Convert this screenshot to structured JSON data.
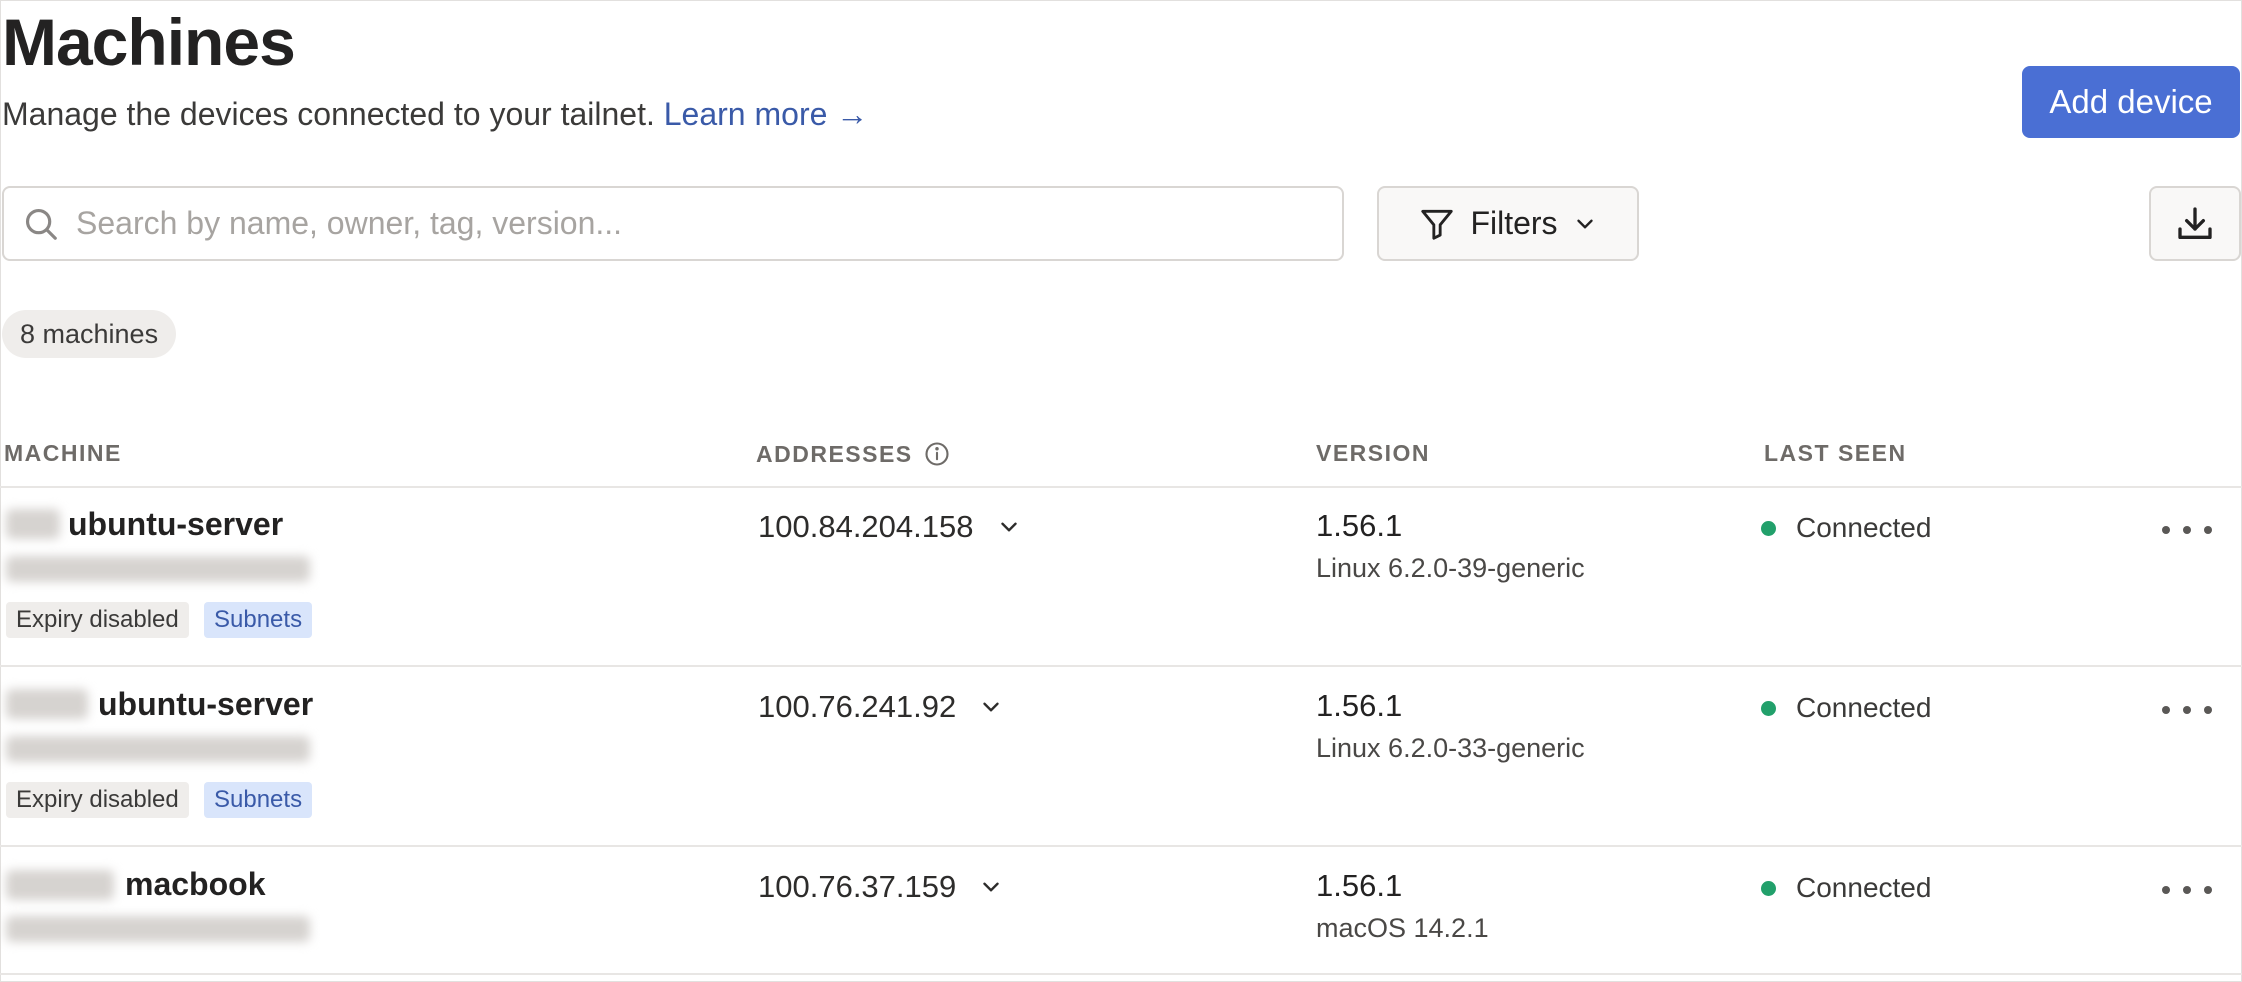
{
  "header": {
    "title": "Machines",
    "subtitle": "Manage the devices connected to your tailnet.",
    "learn_more": "Learn more →",
    "add_device": "Add device"
  },
  "toolbar": {
    "search_placeholder": "Search by name, owner, tag, version...",
    "filters_label": "Filters",
    "icons": {
      "search": "search-icon",
      "filter": "filter-icon",
      "chevron": "chevron-down-icon",
      "download": "download-icon"
    }
  },
  "summary": {
    "count_label": "8 machines"
  },
  "columns": {
    "machine": "MACHINE",
    "addresses": "ADDRESSES",
    "version": "VERSION",
    "last_seen": "LAST SEEN"
  },
  "machines": [
    {
      "name": "ubuntu-server",
      "address": "100.84.204.158",
      "version": "1.56.1",
      "os": "Linux 6.2.0-39-generic",
      "status": "Connected",
      "tags": [
        "Expiry disabled",
        "Subnets"
      ]
    },
    {
      "name": "ubuntu-server",
      "address": "100.76.241.92",
      "version": "1.56.1",
      "os": "Linux 6.2.0-33-generic",
      "status": "Connected",
      "tags": [
        "Expiry disabled",
        "Subnets"
      ]
    },
    {
      "name": "macbook",
      "address": "100.76.37.159",
      "version": "1.56.1",
      "os": "macOS 14.2.1",
      "status": "Connected",
      "tags": []
    }
  ],
  "colors": {
    "accent": "#4a6fd4",
    "link": "#3a5aa8",
    "status_connected": "#22a06b",
    "tag_blue_bg": "#d9e5fb"
  }
}
